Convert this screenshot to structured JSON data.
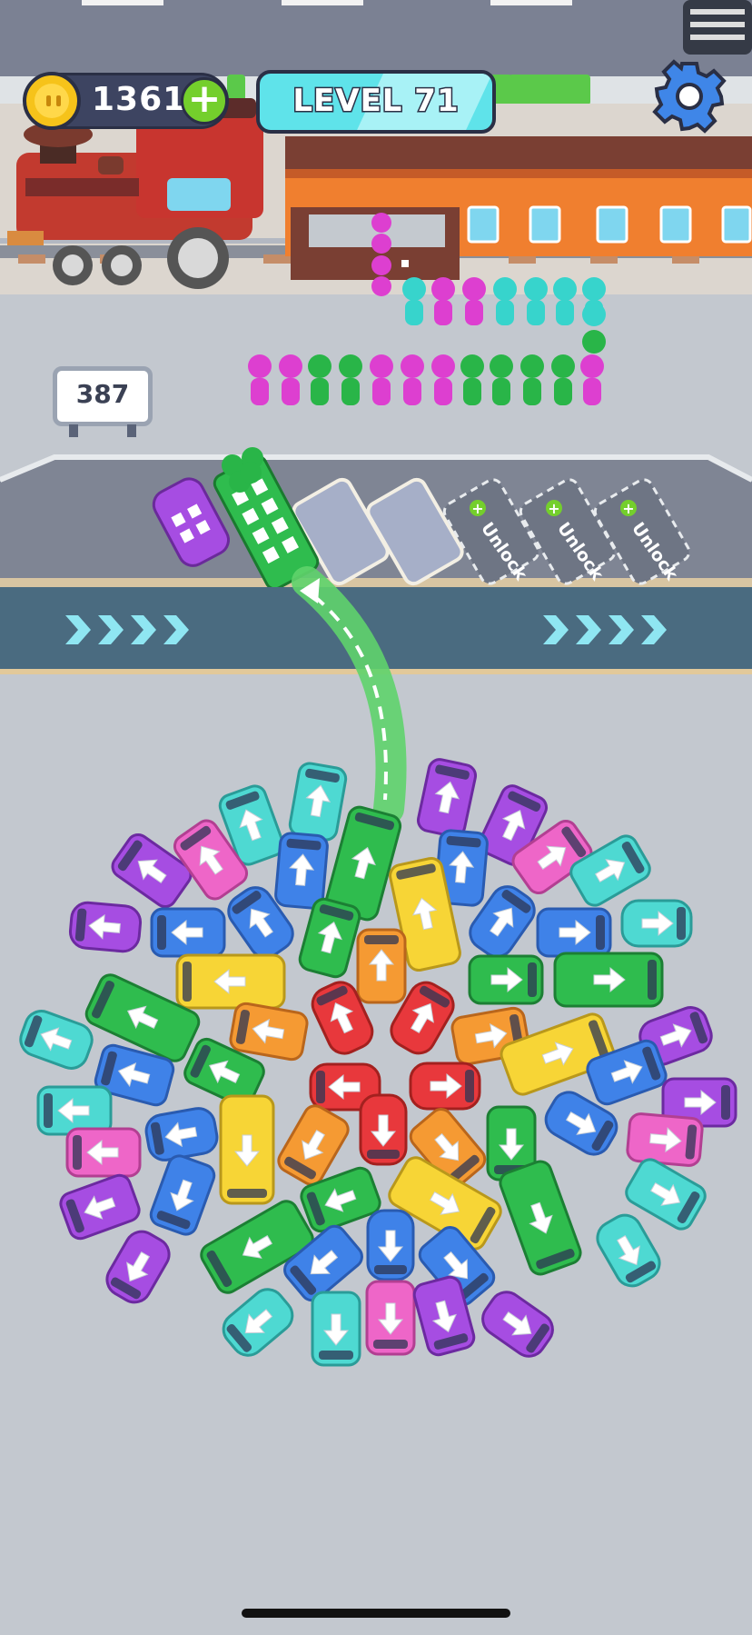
{
  "hud": {
    "coins": "1361",
    "add_coins_icon": "plus-icon",
    "level": "LEVEL 71",
    "settings_icon": "gear-icon"
  },
  "station": {
    "passenger_counter": "387",
    "unlock_label": "Unlock"
  },
  "colors": {
    "purple": "#a64de2",
    "cyan": "#4ed9d2",
    "blue": "#3f82e8",
    "green": "#2fbc4e",
    "yellow": "#f7d536",
    "orange": "#f59a33",
    "red": "#e8383c",
    "pink": "#ee66c8",
    "magenta_passenger": "#dd3fd0",
    "cyan_passenger": "#37d4cc",
    "green_passenger": "#29b548"
  }
}
